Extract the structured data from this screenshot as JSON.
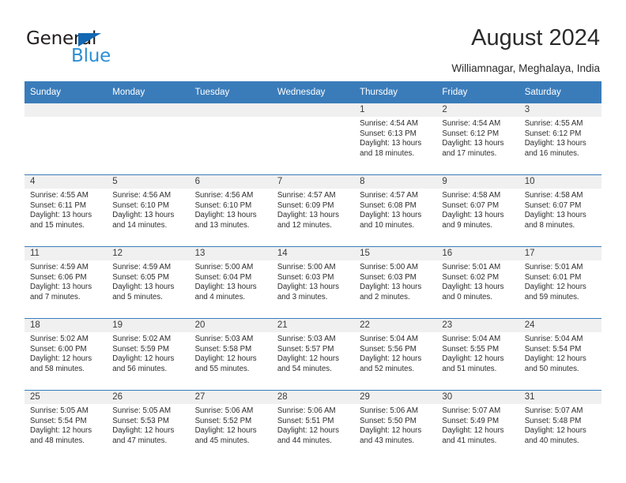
{
  "brand": {
    "name_top": "General",
    "name_bottom": "Blue",
    "triangle_color": "#1268b3",
    "blue_color": "#2b8fd4"
  },
  "header": {
    "title": "August 2024",
    "subtitle": "Williamnagar, Meghalaya, India"
  },
  "theme": {
    "header_blue": "#3a7cba",
    "daynum_band": "#f0f0f0",
    "text": "#2b2b2b"
  },
  "calendar": {
    "weekday_headers": [
      "Sunday",
      "Monday",
      "Tuesday",
      "Wednesday",
      "Thursday",
      "Friday",
      "Saturday"
    ],
    "labels": {
      "sunrise": "Sunrise:",
      "sunset": "Sunset:",
      "daylight": "Daylight:"
    },
    "weeks": [
      [
        {
          "empty": true
        },
        {
          "empty": true
        },
        {
          "empty": true
        },
        {
          "empty": true
        },
        {
          "day": "1",
          "sunrise": "Sunrise: 4:54 AM",
          "sunset": "Sunset: 6:13 PM",
          "daylight": "Daylight: 13 hours and 18 minutes."
        },
        {
          "day": "2",
          "sunrise": "Sunrise: 4:54 AM",
          "sunset": "Sunset: 6:12 PM",
          "daylight": "Daylight: 13 hours and 17 minutes."
        },
        {
          "day": "3",
          "sunrise": "Sunrise: 4:55 AM",
          "sunset": "Sunset: 6:12 PM",
          "daylight": "Daylight: 13 hours and 16 minutes."
        }
      ],
      [
        {
          "day": "4",
          "sunrise": "Sunrise: 4:55 AM",
          "sunset": "Sunset: 6:11 PM",
          "daylight": "Daylight: 13 hours and 15 minutes."
        },
        {
          "day": "5",
          "sunrise": "Sunrise: 4:56 AM",
          "sunset": "Sunset: 6:10 PM",
          "daylight": "Daylight: 13 hours and 14 minutes."
        },
        {
          "day": "6",
          "sunrise": "Sunrise: 4:56 AM",
          "sunset": "Sunset: 6:10 PM",
          "daylight": "Daylight: 13 hours and 13 minutes."
        },
        {
          "day": "7",
          "sunrise": "Sunrise: 4:57 AM",
          "sunset": "Sunset: 6:09 PM",
          "daylight": "Daylight: 13 hours and 12 minutes."
        },
        {
          "day": "8",
          "sunrise": "Sunrise: 4:57 AM",
          "sunset": "Sunset: 6:08 PM",
          "daylight": "Daylight: 13 hours and 10 minutes."
        },
        {
          "day": "9",
          "sunrise": "Sunrise: 4:58 AM",
          "sunset": "Sunset: 6:07 PM",
          "daylight": "Daylight: 13 hours and 9 minutes."
        },
        {
          "day": "10",
          "sunrise": "Sunrise: 4:58 AM",
          "sunset": "Sunset: 6:07 PM",
          "daylight": "Daylight: 13 hours and 8 minutes."
        }
      ],
      [
        {
          "day": "11",
          "sunrise": "Sunrise: 4:59 AM",
          "sunset": "Sunset: 6:06 PM",
          "daylight": "Daylight: 13 hours and 7 minutes."
        },
        {
          "day": "12",
          "sunrise": "Sunrise: 4:59 AM",
          "sunset": "Sunset: 6:05 PM",
          "daylight": "Daylight: 13 hours and 5 minutes."
        },
        {
          "day": "13",
          "sunrise": "Sunrise: 5:00 AM",
          "sunset": "Sunset: 6:04 PM",
          "daylight": "Daylight: 13 hours and 4 minutes."
        },
        {
          "day": "14",
          "sunrise": "Sunrise: 5:00 AM",
          "sunset": "Sunset: 6:03 PM",
          "daylight": "Daylight: 13 hours and 3 minutes."
        },
        {
          "day": "15",
          "sunrise": "Sunrise: 5:00 AM",
          "sunset": "Sunset: 6:03 PM",
          "daylight": "Daylight: 13 hours and 2 minutes."
        },
        {
          "day": "16",
          "sunrise": "Sunrise: 5:01 AM",
          "sunset": "Sunset: 6:02 PM",
          "daylight": "Daylight: 13 hours and 0 minutes."
        },
        {
          "day": "17",
          "sunrise": "Sunrise: 5:01 AM",
          "sunset": "Sunset: 6:01 PM",
          "daylight": "Daylight: 12 hours and 59 minutes."
        }
      ],
      [
        {
          "day": "18",
          "sunrise": "Sunrise: 5:02 AM",
          "sunset": "Sunset: 6:00 PM",
          "daylight": "Daylight: 12 hours and 58 minutes."
        },
        {
          "day": "19",
          "sunrise": "Sunrise: 5:02 AM",
          "sunset": "Sunset: 5:59 PM",
          "daylight": "Daylight: 12 hours and 56 minutes."
        },
        {
          "day": "20",
          "sunrise": "Sunrise: 5:03 AM",
          "sunset": "Sunset: 5:58 PM",
          "daylight": "Daylight: 12 hours and 55 minutes."
        },
        {
          "day": "21",
          "sunrise": "Sunrise: 5:03 AM",
          "sunset": "Sunset: 5:57 PM",
          "daylight": "Daylight: 12 hours and 54 minutes."
        },
        {
          "day": "22",
          "sunrise": "Sunrise: 5:04 AM",
          "sunset": "Sunset: 5:56 PM",
          "daylight": "Daylight: 12 hours and 52 minutes."
        },
        {
          "day": "23",
          "sunrise": "Sunrise: 5:04 AM",
          "sunset": "Sunset: 5:55 PM",
          "daylight": "Daylight: 12 hours and 51 minutes."
        },
        {
          "day": "24",
          "sunrise": "Sunrise: 5:04 AM",
          "sunset": "Sunset: 5:54 PM",
          "daylight": "Daylight: 12 hours and 50 minutes."
        }
      ],
      [
        {
          "day": "25",
          "sunrise": "Sunrise: 5:05 AM",
          "sunset": "Sunset: 5:54 PM",
          "daylight": "Daylight: 12 hours and 48 minutes."
        },
        {
          "day": "26",
          "sunrise": "Sunrise: 5:05 AM",
          "sunset": "Sunset: 5:53 PM",
          "daylight": "Daylight: 12 hours and 47 minutes."
        },
        {
          "day": "27",
          "sunrise": "Sunrise: 5:06 AM",
          "sunset": "Sunset: 5:52 PM",
          "daylight": "Daylight: 12 hours and 45 minutes."
        },
        {
          "day": "28",
          "sunrise": "Sunrise: 5:06 AM",
          "sunset": "Sunset: 5:51 PM",
          "daylight": "Daylight: 12 hours and 44 minutes."
        },
        {
          "day": "29",
          "sunrise": "Sunrise: 5:06 AM",
          "sunset": "Sunset: 5:50 PM",
          "daylight": "Daylight: 12 hours and 43 minutes."
        },
        {
          "day": "30",
          "sunrise": "Sunrise: 5:07 AM",
          "sunset": "Sunset: 5:49 PM",
          "daylight": "Daylight: 12 hours and 41 minutes."
        },
        {
          "day": "31",
          "sunrise": "Sunrise: 5:07 AM",
          "sunset": "Sunset: 5:48 PM",
          "daylight": "Daylight: 12 hours and 40 minutes."
        }
      ]
    ]
  }
}
